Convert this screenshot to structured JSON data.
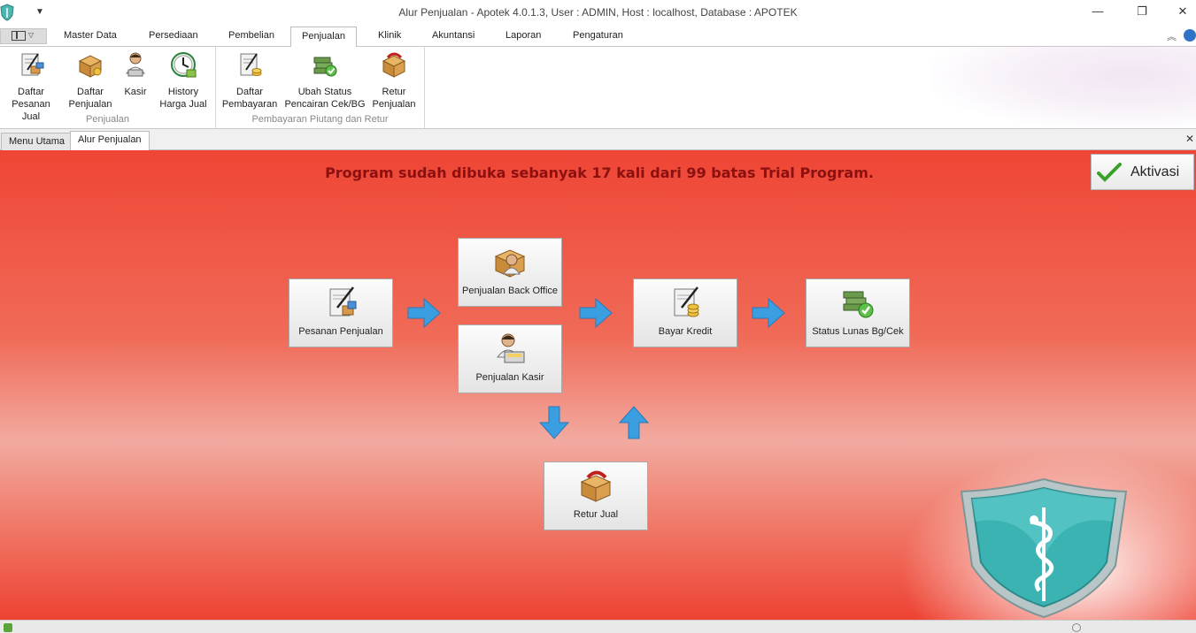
{
  "window": {
    "title": "Alur Penjualan - Apotek 4.0.1.3,  User : ADMIN, Host : localhost, Database : APOTEK",
    "minimize_glyph": "—",
    "restore_glyph": "❐",
    "close_glyph": "✕"
  },
  "ribbon_tabs": [
    {
      "label": "Master Data"
    },
    {
      "label": "Persediaan"
    },
    {
      "label": "Pembelian"
    },
    {
      "label": "Penjualan",
      "active": true
    },
    {
      "label": "Klinik"
    },
    {
      "label": "Akuntansi"
    },
    {
      "label": "Laporan"
    },
    {
      "label": "Pengaturan"
    }
  ],
  "ribbon_groups": [
    {
      "label": "Penjualan",
      "buttons": [
        {
          "line1": "Daftar",
          "line2": "Pesanan Jual",
          "icon": "order-list-icon"
        },
        {
          "line1": "Daftar",
          "line2": "Penjualan",
          "icon": "sales-box-icon"
        },
        {
          "line1": "Kasir",
          "line2": "",
          "icon": "cashier-icon"
        },
        {
          "line1": "History",
          "line2": "Harga Jual",
          "icon": "price-history-icon"
        }
      ]
    },
    {
      "label": "Pembayaran Piutang dan Retur",
      "buttons": [
        {
          "line1": "Daftar",
          "line2": "Pembayaran",
          "icon": "payment-list-icon"
        },
        {
          "line1": "Ubah Status",
          "line2": "Pencairan Cek/BG",
          "icon": "cheque-status-icon"
        },
        {
          "line1": "Retur",
          "line2": "Penjualan",
          "icon": "sales-return-icon"
        }
      ]
    }
  ],
  "doc_tabs": [
    {
      "label": "Menu Utama"
    },
    {
      "label": "Alur Penjualan",
      "active": true
    }
  ],
  "main": {
    "trial_message": "Program sudah dibuka sebanyak 17 kali dari 99 batas Trial Program.",
    "activate_label": "Aktivasi",
    "flow": {
      "pesanan": "Pesanan Penjualan",
      "back_office": "Penjualan Back Office",
      "kasir": "Penjualan Kasir",
      "bayar_kredit": "Bayar Kredit",
      "status_lunas": "Status Lunas Bg/Cek",
      "retur": "Retur Jual"
    }
  },
  "colors": {
    "main_red": "#ef4535",
    "trial_text": "#8b1010",
    "arrow_blue": "#3a9ee0",
    "shield_teal": "#3bb3b3"
  }
}
